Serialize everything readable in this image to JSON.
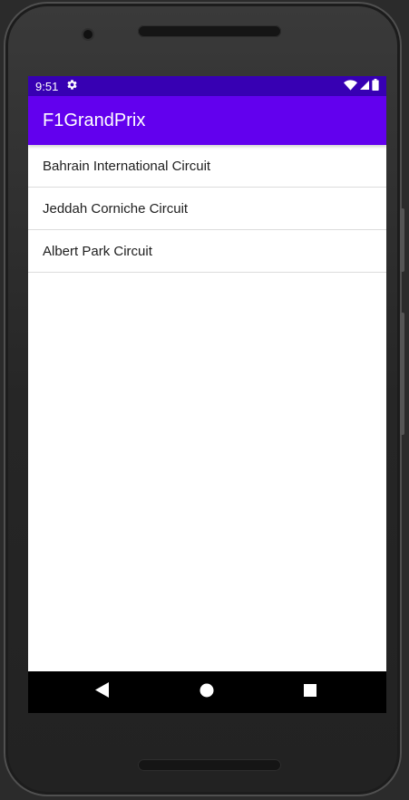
{
  "status_bar": {
    "time": "9:51",
    "icons": [
      "settings-icon",
      "wifi-icon",
      "cell-signal-icon",
      "battery-icon"
    ]
  },
  "app_bar": {
    "title": "F1GrandPrix"
  },
  "circuits": [
    {
      "label": "Bahrain International Circuit"
    },
    {
      "label": "Jeddah Corniche Circuit"
    },
    {
      "label": "Albert Park Circuit"
    }
  ],
  "nav_bar": {
    "buttons": [
      "back-icon",
      "home-icon",
      "recents-icon"
    ]
  },
  "colors": {
    "status_bar": "#3700b3",
    "app_bar": "#6200ee",
    "background": "#ffffff",
    "divider": "#dcdcdc"
  }
}
